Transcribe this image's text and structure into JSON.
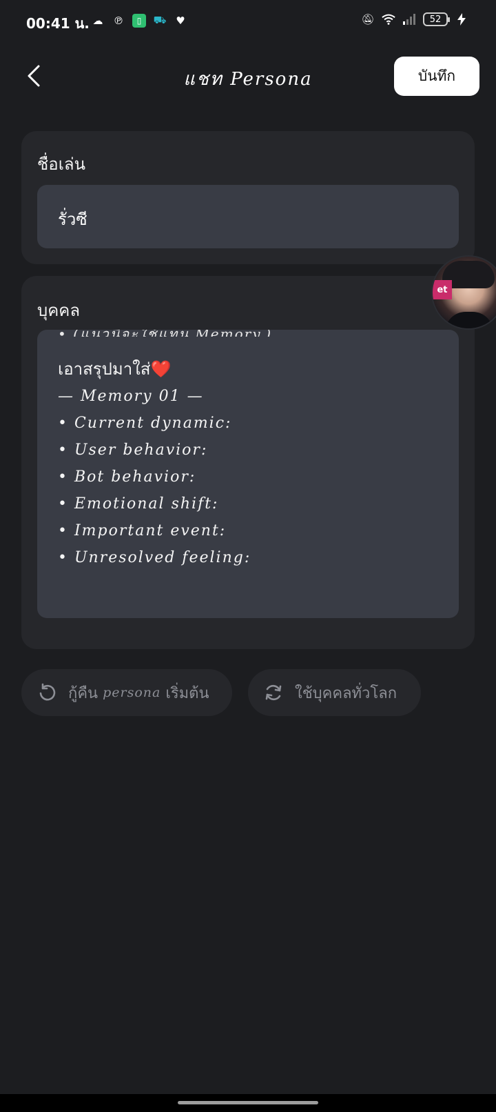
{
  "status_bar": {
    "time": "00:41 น.",
    "battery": "52"
  },
  "header": {
    "title": "แชท Persona",
    "save_label": "บันทึก"
  },
  "nickname": {
    "label": "ชื่อเล่น",
    "value": "รั่วซี"
  },
  "persona": {
    "label": "บุคคล",
    "partial_line": "• (แนวนี้จะใช้แทน Memory.)",
    "lines": [
      "เอาสรุปมาใส่❤️",
      "— Memory 01 —",
      "• Current dynamic:",
      "• User behavior:",
      "• Bot behavior:",
      "• Emotional shift:",
      "• Important event:",
      "• Unresolved feeling:"
    ]
  },
  "avatar_badge": "et",
  "actions": {
    "restore_prefix": "กู้คืน ",
    "restore_latin": "persona",
    "restore_suffix": " เริ่มต้น",
    "global_label": "ใช้บุคคลทั่วโลก"
  },
  "icons": {
    "back": "chevron-left-icon",
    "restore": "undo-icon",
    "global": "sync-icon"
  }
}
